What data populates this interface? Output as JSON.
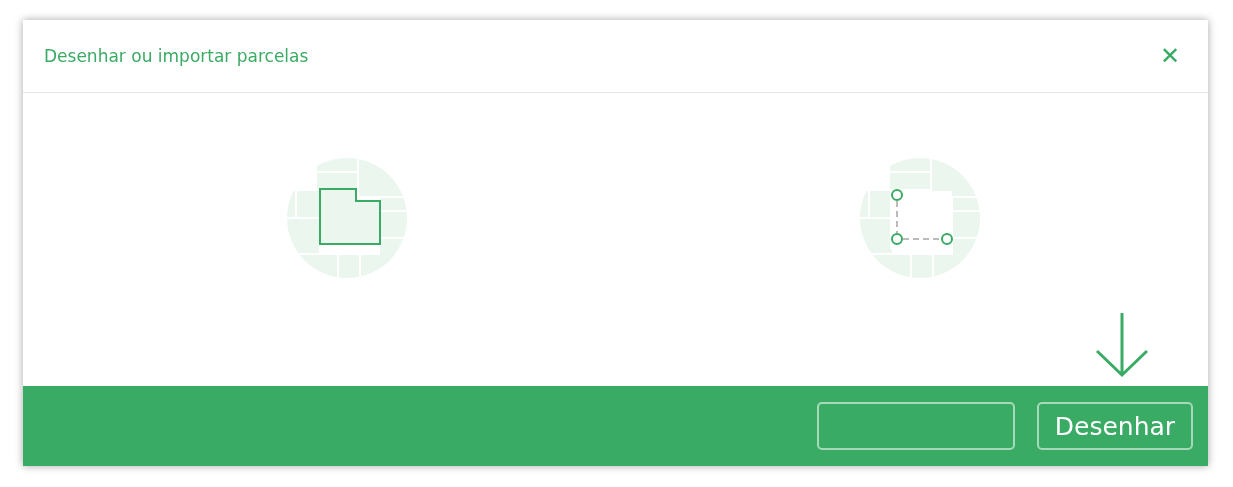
{
  "dialog": {
    "title": "Desenhar ou importar parcelas",
    "close_label": "✕"
  },
  "options": [
    {
      "kind": "parcel"
    },
    {
      "kind": "points"
    }
  ],
  "footer": {
    "pointer": true,
    "buttons": [
      {
        "kind": "blank"
      },
      {
        "kind": "text",
        "label": "Desenhar"
      }
    ]
  }
}
